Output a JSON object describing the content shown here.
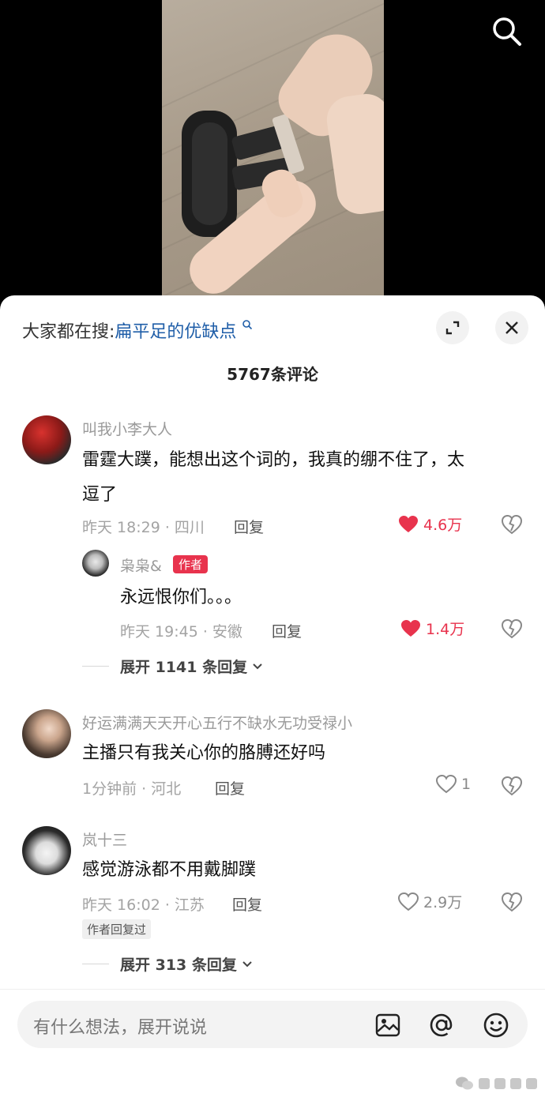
{
  "video": {
    "search_icon": "search-icon"
  },
  "sheet": {
    "search_prefix": "大家都在搜:",
    "search_keyword": "扁平足的优缺点",
    "comment_count": "5767条评论"
  },
  "comments": [
    {
      "username": "叫我小李大人",
      "text_line1": "雷霆大蹼，能想出这个词的，我真的绷不住了，太",
      "text_line2": "逗了",
      "meta": "昨天 18:29 · 四川",
      "reply_label": "回复",
      "likes": "4.6万",
      "liked": true,
      "sub_reply": {
        "username": "枭枭&",
        "badge": "作者",
        "text": "永远恨你们。。。",
        "meta": "昨天 19:45 · 安徽",
        "reply_label": "回复",
        "likes": "1.4万",
        "liked": true
      },
      "expand_label": "展开 1141 条回复"
    },
    {
      "username": "好运满满天天开心五行不缺水无功受禄小",
      "text_line1": "主播只有我关心你的胳膊还好吗",
      "meta": "1分钟前 · 河北",
      "reply_label": "回复",
      "likes": "1",
      "liked": false
    },
    {
      "username": "岚十三",
      "text_line1": "感觉游泳都不用戴脚蹼",
      "meta": "昨天 16:02 · 江苏",
      "reply_label": "回复",
      "likes": "2.9万",
      "liked": false,
      "author_tag": "作者回复过",
      "expand_label": "展开 313 条回复"
    }
  ],
  "input": {
    "placeholder": "有什么想法，展开说说",
    "icons": [
      "image-icon",
      "at-icon",
      "emoji-icon"
    ]
  },
  "colors": {
    "like_red": "#e8334d",
    "keyword_blue": "#1f5ea8"
  }
}
